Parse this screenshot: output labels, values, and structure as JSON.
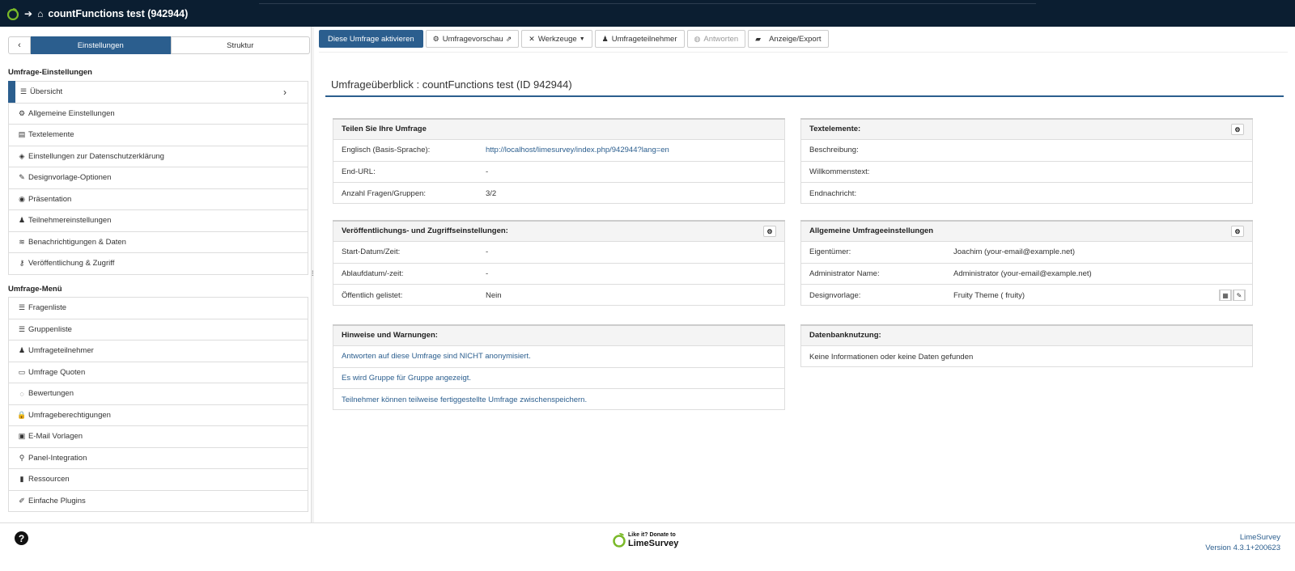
{
  "topbar": {
    "title": "countFunctions test (942944)"
  },
  "sidebar": {
    "tabs": [
      "Einstellungen",
      "Struktur"
    ],
    "section1_title": "Umfrage-Einstellungen",
    "settings": [
      {
        "label": "Übersicht",
        "icon": "☰"
      },
      {
        "label": "Allgemeine Einstellungen",
        "icon": "⚙"
      },
      {
        "label": "Textelemente",
        "icon": "▤"
      },
      {
        "label": "Einstellungen zur Datenschutzerklärung",
        "icon": "◈"
      },
      {
        "label": "Designvorlage-Optionen",
        "icon": "✎"
      },
      {
        "label": "Präsentation",
        "icon": "◉"
      },
      {
        "label": "Teilnehmereinstellungen",
        "icon": "♟"
      },
      {
        "label": "Benachrichtigungen & Daten",
        "icon": "≋"
      },
      {
        "label": "Veröffentlichung & Zugriff",
        "icon": "⚷"
      }
    ],
    "section2_title": "Umfrage-Menü",
    "menu": [
      {
        "label": "Fragenliste",
        "icon": "☰"
      },
      {
        "label": "Gruppenliste",
        "icon": "☰"
      },
      {
        "label": "Umfrageteilnehmer",
        "icon": "♟"
      },
      {
        "label": "Umfrage Quoten",
        "icon": "▭"
      },
      {
        "label": "Bewertungen",
        "icon": "◌"
      },
      {
        "label": "Umfrageberechtigungen",
        "icon": "🔒"
      },
      {
        "label": "E-Mail Vorlagen",
        "icon": "▣"
      },
      {
        "label": "Panel-Integration",
        "icon": "⚲"
      },
      {
        "label": "Ressourcen",
        "icon": "▮"
      },
      {
        "label": "Einfache Plugins",
        "icon": "✐"
      }
    ]
  },
  "toolbar": {
    "activate": "Diese Umfrage aktivieren",
    "preview": "Umfragevorschau",
    "tools": "Werkzeuge",
    "participants": "Umfrageteilnehmer",
    "responses": "Antworten",
    "display_export": "Anzeige/Export"
  },
  "page_title": "Umfrageüberblick : countFunctions test (ID 942944)",
  "panels": {
    "share": {
      "title": "Teilen Sie Ihre Umfrage",
      "rows": [
        {
          "k": "Englisch (Basis-Sprache):",
          "v": "http://localhost/limesurvey/index.php/942944?lang=en"
        },
        {
          "k": "End-URL:",
          "v": "-"
        },
        {
          "k": "Anzahl Fragen/Gruppen:",
          "v": "3/2"
        }
      ]
    },
    "text": {
      "title": "Textelemente:",
      "rows": [
        {
          "k": "Beschreibung:",
          "v": ""
        },
        {
          "k": "Willkommenstext:",
          "v": ""
        },
        {
          "k": "Endnachricht:",
          "v": ""
        }
      ]
    },
    "publish": {
      "title": "Veröffentlichungs- und Zugriffseinstellungen:",
      "rows": [
        {
          "k": "Start-Datum/Zeit:",
          "v": "-"
        },
        {
          "k": "Ablaufdatum/-zeit:",
          "v": "-"
        },
        {
          "k": "Öffentlich gelistet:",
          "v": "Nein"
        }
      ]
    },
    "general": {
      "title": "Allgemeine Umfrageeinstellungen",
      "rows": [
        {
          "k": "Eigentümer:",
          "v": "Joachim (your-email@example.net)"
        },
        {
          "k": "Administrator Name:",
          "v": "Administrator (your-email@example.net)"
        },
        {
          "k": "Designvorlage:",
          "v": "Fruity Theme ( fruity)"
        }
      ]
    },
    "warnings": {
      "title": "Hinweise und Warnungen:",
      "rows": [
        "Antworten auf diese Umfrage sind NICHT anonymisiert.",
        "Es wird Gruppe für Gruppe angezeigt.",
        "Teilnehmer können teilweise fertiggestellte Umfrage zwischenspeichern."
      ]
    },
    "db": {
      "title": "Datenbanknutzung:",
      "rows": [
        "Keine Informationen oder keine Daten gefunden"
      ]
    }
  },
  "footer": {
    "donate_line1": "Like it? Donate to",
    "donate_line2": "LimeSurvey",
    "brand": "LimeSurvey",
    "version": "Version 4.3.1+200623"
  },
  "colors": {
    "topbar": "#0b1e31",
    "accent": "#2b5e8e",
    "lime": "#7ab929"
  }
}
